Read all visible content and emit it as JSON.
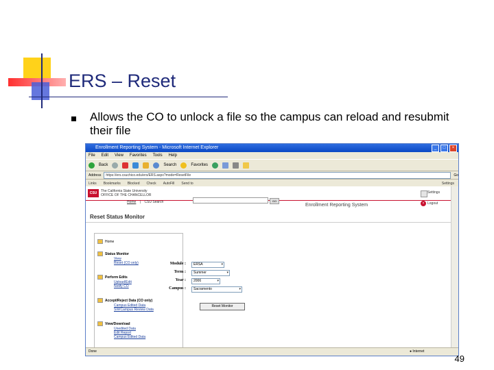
{
  "slide": {
    "title": "ERS – Reset",
    "bullet": "Allows the CO to unlock a file so the campus can reload and resubmit their file",
    "page_number": "49"
  },
  "browser": {
    "window_title": "Enrollment Reporting System - Microsoft Internet Explorer",
    "menu": [
      "File",
      "Edit",
      "View",
      "Favorites",
      "Tools",
      "Help"
    ],
    "toolbar": {
      "back": "Back",
      "search": "Search",
      "favorites": "Favorites"
    },
    "address_label": "Address",
    "address_value": "https://ers.csuchico.edu/ers/ERS.aspx?mode=ResetFile",
    "go_label": "Go",
    "links_label": "Links",
    "links": [
      "Bookmarks",
      "Blocked",
      "Check",
      "AutoFill",
      "Send to",
      "Settings"
    ],
    "status_text": "Done",
    "status_zone": "Internet",
    "colors": {
      "titlebar": "#0a48c4",
      "chrome": "#ece9d8",
      "accent_red": "#c8102e",
      "slide_title": "#1f2a7a"
    }
  },
  "site": {
    "logo": "CSU",
    "logo_title": "The California State University",
    "logo_subtitle": "OFFICE OF THE CHANCELLOR",
    "nav_home": "Home",
    "nav_sep": "|",
    "nav_search": "CSU Search",
    "go_button": "GO",
    "system_title": "Enrollment Reporting System",
    "user_label": "Settings",
    "logout_label": "Logout",
    "page_heading": "Reset Status Monitor"
  },
  "sidebar": {
    "home": "Home",
    "sections": [
      {
        "title": "Status Monitor",
        "links": [
          "View",
          "Reset (CO only)"
        ]
      },
      {
        "title": "Perform Edits",
        "links": [
          "Upload/Edit",
          "Notify CO"
        ]
      },
      {
        "title": "Accept/Reject Data (CO only)",
        "links": [
          "Campus Edited Data",
          "SW/Campus Review Data"
        ]
      },
      {
        "title": "View/Download",
        "links": [
          "Unedited Data",
          "Edit Report",
          "Campus Edited Data"
        ]
      }
    ]
  },
  "form": {
    "module_label": "Module :",
    "module_value": "ERSA",
    "term_label": "Term :",
    "term_value": "Summer",
    "year_label": "Year :",
    "year_value": "2006",
    "campus_label": "Campus :",
    "campus_value": "Sacramento",
    "reset_button": "Reset Monitor"
  }
}
